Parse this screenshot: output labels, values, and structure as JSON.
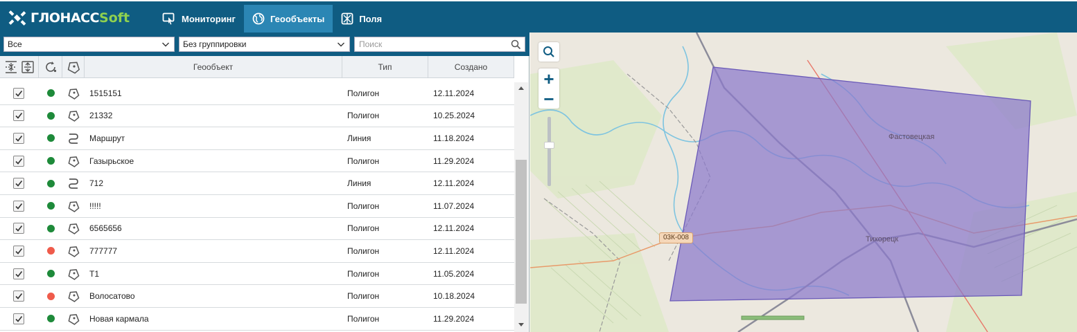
{
  "header": {
    "logo_main": "ГЛОНАСС",
    "logo_soft": "Soft",
    "nav": [
      {
        "label": "Мониторинг",
        "icon": "monitor-pointer-icon",
        "active": false
      },
      {
        "label": "Геообъекты",
        "icon": "geofence-globe-icon",
        "active": true
      },
      {
        "label": "Поля",
        "icon": "field-grid-icon",
        "active": false
      }
    ]
  },
  "filters": {
    "filter_value": "Все",
    "grouping_value": "Без группировки",
    "search_placeholder": "Поиск"
  },
  "table": {
    "columns": {
      "name": "Геообъект",
      "type": "Тип",
      "created": "Создано"
    },
    "rows": [
      {
        "checked": true,
        "status": "green",
        "kind": "polygon",
        "name": "1515151",
        "type": "Полигон",
        "created": "12.11.2024"
      },
      {
        "checked": true,
        "status": "green",
        "kind": "polygon",
        "name": "21332",
        "type": "Полигон",
        "created": "10.25.2024"
      },
      {
        "checked": true,
        "status": "green",
        "kind": "line",
        "name": "Маршрут",
        "type": "Линия",
        "created": "11.18.2024"
      },
      {
        "checked": true,
        "status": "green",
        "kind": "polygon",
        "name": "Газырьское",
        "type": "Полигон",
        "created": "11.29.2024"
      },
      {
        "checked": true,
        "status": "green",
        "kind": "line",
        "name": "712",
        "type": "Линия",
        "created": "12.11.2024"
      },
      {
        "checked": true,
        "status": "green",
        "kind": "polygon",
        "name": "!!!!!",
        "type": "Полигон",
        "created": "11.07.2024"
      },
      {
        "checked": true,
        "status": "green",
        "kind": "polygon",
        "name": "6565656",
        "type": "Полигон",
        "created": "12.11.2024"
      },
      {
        "checked": true,
        "status": "red",
        "kind": "polygon",
        "name": "777777",
        "type": "Полигон",
        "created": "12.11.2024"
      },
      {
        "checked": true,
        "status": "green",
        "kind": "polygon",
        "name": "Т1",
        "type": "Полигон",
        "created": "11.05.2024"
      },
      {
        "checked": true,
        "status": "red",
        "kind": "polygon",
        "name": "Волосатово",
        "type": "Полигон",
        "created": "10.18.2024"
      },
      {
        "checked": true,
        "status": "green",
        "kind": "polygon",
        "name": "Новая кармала",
        "type": "Полигон",
        "created": "11.29.2024"
      }
    ]
  },
  "map": {
    "labels": {
      "town1": "Фастовецкая",
      "town2": "Тихорецк",
      "road": "03К-008"
    },
    "zoom_in": "+",
    "zoom_out": "−"
  },
  "colors": {
    "header": "#0f5c82",
    "nav_active": "#2b86b4",
    "status_green": "#1e8a3a",
    "status_red": "#ef5b4b",
    "polygon_fill": "#8a78cc",
    "polygon_stroke": "#6a5ab8"
  }
}
